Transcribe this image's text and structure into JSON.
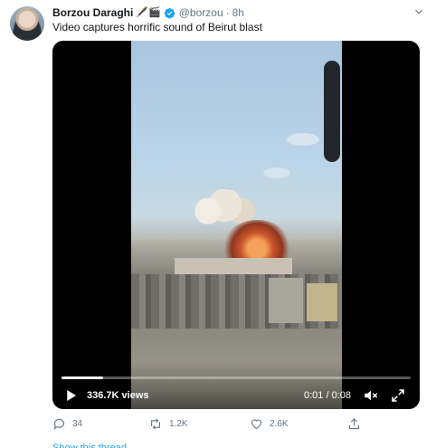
{
  "tweet": {
    "author_name": "Borzou Daraghi",
    "author_emojis": "🖋️🎬",
    "handle": "@borzou",
    "separator": "·",
    "time": "8h",
    "text": "Video captures horrific sound of Beirut blast"
  },
  "video": {
    "views": "336.7K views",
    "timecode": "0:01 / 0:08",
    "progress": 0.12
  },
  "actions": {
    "replies": "34",
    "retweets": "1.2K",
    "likes": "2.6K"
  },
  "footer": {
    "thread_link": "Show this thread"
  },
  "colors": {
    "accent": "#1da1f2",
    "secondary_text": "#657786",
    "primary_text": "#14171a"
  }
}
